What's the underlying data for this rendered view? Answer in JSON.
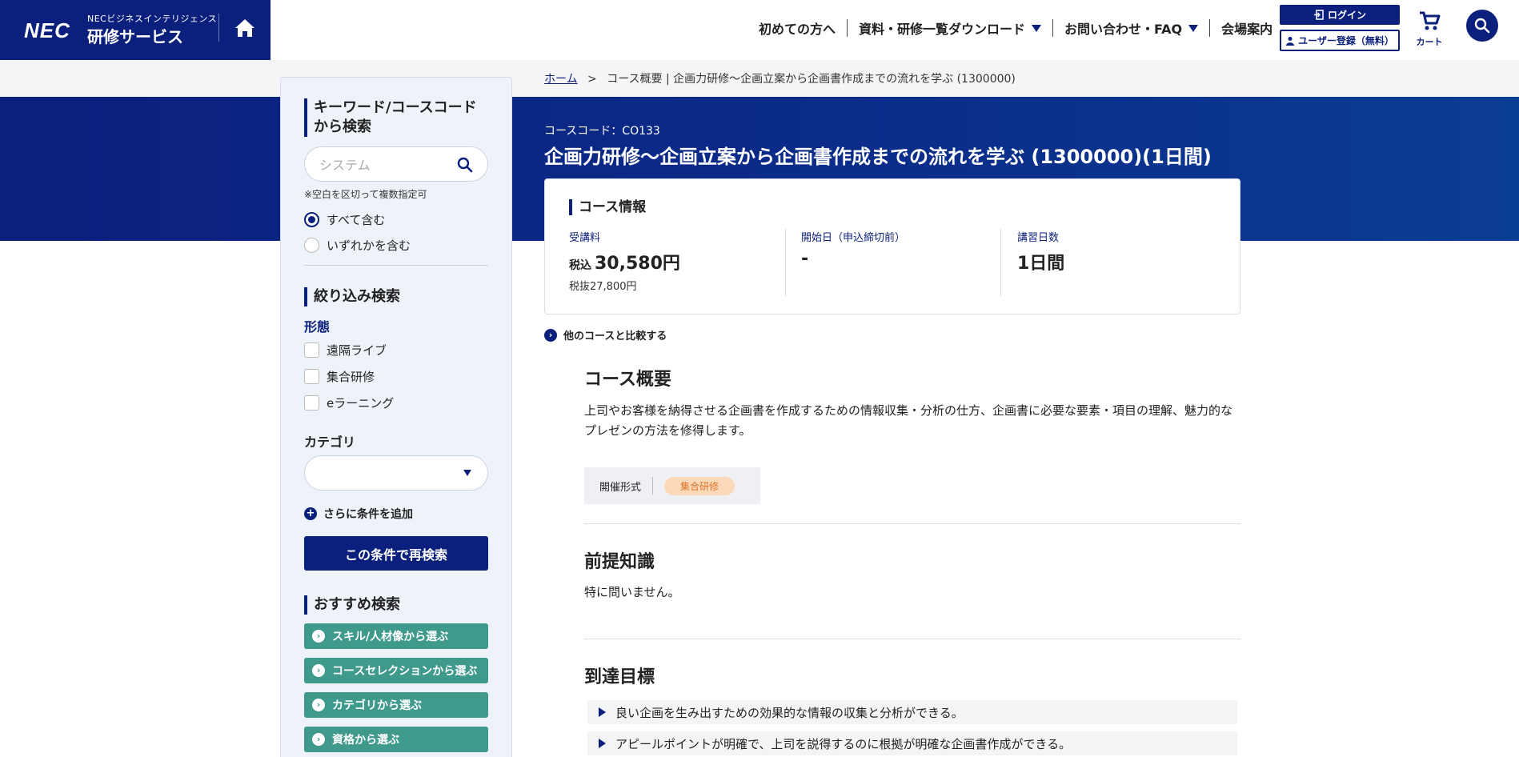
{
  "brand": {
    "logo": "NEC",
    "sub": "NECビジネスインテリジェンス",
    "service": "研修サービス"
  },
  "nav": {
    "items": [
      {
        "label": "初めての方へ",
        "dropdown": false
      },
      {
        "label": "資料・研修一覧ダウンロード",
        "dropdown": true
      },
      {
        "label": "お問い合わせ・FAQ",
        "dropdown": true
      },
      {
        "label": "会場案内",
        "dropdown": false
      }
    ],
    "login": "ログイン",
    "register": "ユーザー登録（無料）",
    "cart": "カート"
  },
  "breadcrumb": {
    "home": "ホーム",
    "separator": ">",
    "current": "コース概要 | 企画力研修～企画立案から企画書作成までの流れを学ぶ (1300000)"
  },
  "sidebar": {
    "keyword_heading": "キーワード/コースコードから検索",
    "search_placeholder": "システム",
    "note": "※空白を区切って複数指定可",
    "radio_all": "すべて含む",
    "radio_any": "いずれかを含む",
    "filter_heading": "絞り込み検索",
    "format_label": "形態",
    "formats": [
      "遠隔ライブ",
      "集合研修",
      "eラーニング"
    ],
    "category_label": "カテゴリ",
    "add_condition": "さらに条件を追加",
    "research_button": "この条件で再検索",
    "recommend_heading": "おすすめ検索",
    "recommend": [
      "スキル/人材像から選ぶ",
      "コースセレクションから選ぶ",
      "カテゴリから選ぶ",
      "資格から選ぶ"
    ]
  },
  "course": {
    "code": "コースコード：CO133",
    "title": "企画力研修～企画立案から企画書作成までの流れを学ぶ (1300000)(1日間)",
    "info_heading": "コース情報",
    "fee_label": "受講料",
    "fee_tax_prefix": "税込",
    "fee_value": "30,580円",
    "fee_excl": "税抜27,800円",
    "start_label": "開始日（申込締切前）",
    "start_value": "-",
    "days_label": "講習日数",
    "days_value": "1日間",
    "compare": "他のコースと比較する"
  },
  "overview": {
    "heading": "コース概要",
    "text": "上司やお客様を納得させる企画書を作成するための情報収集・分析の仕方、企画書に必要な要素・項目の理解、魅力的なプレゼンの方法を修得します。",
    "format_label": "開催形式",
    "format_value": "集合研修"
  },
  "prerequisite": {
    "heading": "前提知識",
    "text": "特に問いません。"
  },
  "goals": {
    "heading": "到達目標",
    "items": [
      "良い企画を生み出すための効果的な情報の収集と分析ができる。",
      "アピールポイントが明確で、上司を説得するのに根拠が明確な企画書作成ができる。"
    ]
  },
  "colors": {
    "brand": "#0b1f7c",
    "green": "#3f9a8c",
    "pill": "#fcd9b8"
  }
}
